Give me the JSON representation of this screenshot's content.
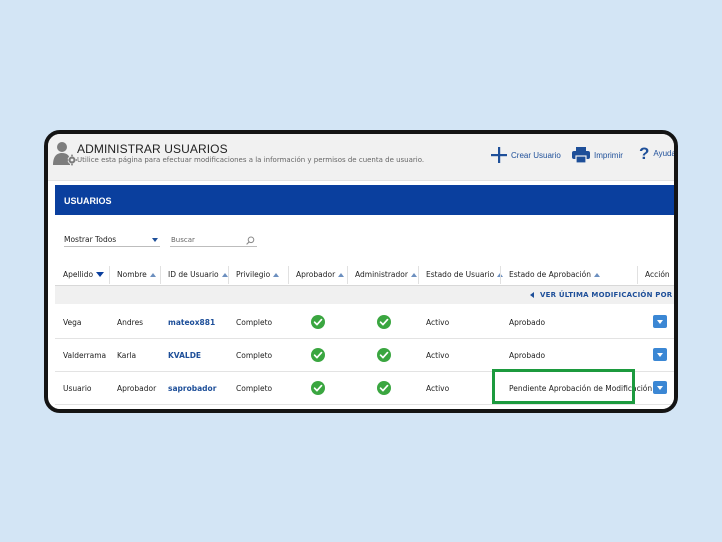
{
  "header": {
    "title": "ADMINISTRAR USUARIOS",
    "subtitle": "Utilice esta página para efectuar modificaciones a la información y permisos de cuenta de usuario.",
    "create_user": "Crear Usuario",
    "print": "Imprimir",
    "help": "Ayuda",
    "icons": [
      "user-gear-icon",
      "plus-icon",
      "printer-icon",
      "question-icon"
    ]
  },
  "section": {
    "title": "USUARIOS"
  },
  "filter": {
    "selected": "Mostrar Todos"
  },
  "search": {
    "placeholder": "Buscar"
  },
  "table": {
    "columns": [
      "Apellido",
      "Nombre",
      "ID de Usuario",
      "Privilegio",
      "Aprobador",
      "Administrador",
      "Estado de Usuario",
      "Estado de Aprobación",
      "Acción"
    ],
    "mod_link": "VER ÚLTIMA MODIFICACIÓN POR",
    "rows": [
      {
        "apellido": "Vega",
        "nombre": "Andres",
        "id": "mateox881",
        "privilegio": "Completo",
        "aprobador": true,
        "administrador": true,
        "estado": "Activo",
        "aprobacion": "Aprobado"
      },
      {
        "apellido": "Valderrama",
        "nombre": "Karla",
        "id": "KVALDE",
        "privilegio": "Completo",
        "aprobador": true,
        "administrador": true,
        "estado": "Activo",
        "aprobacion": "Aprobado"
      },
      {
        "apellido": "Usuario",
        "nombre": "Aprobador",
        "id": "saprobador",
        "privilegio": "Completo",
        "aprobador": true,
        "administrador": true,
        "estado": "Activo",
        "aprobacion": "Pendiente Aprobación de Modificación"
      }
    ]
  },
  "colors": {
    "band": "#0a3f9e",
    "link": "#1e4f99",
    "check": "#3aa640",
    "highlight": "#1c9a3e",
    "background": "#d3e5f5"
  }
}
